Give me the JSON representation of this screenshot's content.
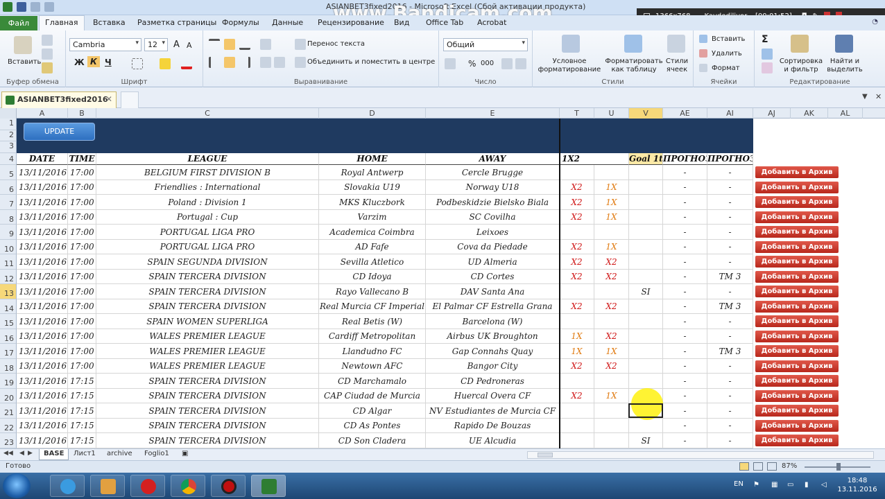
{
  "window": {
    "title": "ASIANBET3fixed2016 - Microsoft Excel (Сбой активации продукта)",
    "watermark": "www.Bandicam.com",
    "recorder_resolution": "1366x768",
    "recorder_status": "Kaydediliyor... [00:01:52]"
  },
  "menu": {
    "file": "Файл",
    "tabs": [
      "Главная",
      "Вставка",
      "Разметка страницы",
      "Формулы",
      "Данные",
      "Рецензирование",
      "Вид",
      "Office Tab",
      "Acrobat"
    ]
  },
  "ribbon": {
    "clipboard": {
      "paste": "Вставить",
      "label": "Буфер обмена"
    },
    "font": {
      "name": "Cambria",
      "size": "12",
      "label": "Шрифт",
      "bold": "Ж",
      "italic": "К",
      "underline": "Ч"
    },
    "alignment": {
      "wrap": "Перенос текста",
      "merge": "Объединить и поместить в центре",
      "label": "Выравнивание"
    },
    "number": {
      "format": "Общий",
      "label": "Число",
      "percent": "%",
      "thousands": "000"
    },
    "styles": {
      "conditional": "Условное форматирование",
      "as_table": "Форматировать как таблицу",
      "cell_styles": "Стили ячеек",
      "label": "Стили"
    },
    "cells": {
      "insert": "Вставить",
      "delete": "Удалить",
      "format": "Формат",
      "label": "Ячейки"
    },
    "editing": {
      "sort": "Сортировка и фильтр",
      "find": "Найти и выделить",
      "label": "Редактирование"
    }
  },
  "doc_tab": "ASIANBET3fixed2016",
  "columns": [
    "A",
    "B",
    "C",
    "D",
    "E",
    "T",
    "U",
    "V",
    "AE",
    "AI",
    "AJ",
    "AK",
    "AL"
  ],
  "update_button": "UPDATE",
  "headers": {
    "date": "DATE",
    "time": "TIME",
    "league": "LEAGUE",
    "home": "HOME",
    "away": "AWAY",
    "x12": "1X2",
    "goal": "Goal 1t",
    "prog1": "ПРОГНОЗ",
    "prog2": "ПРОГНОЗ"
  },
  "archive_label": "Добавить в Архив",
  "rows": [
    {
      "n": "5",
      "date": "13/11/2016",
      "time": "17:00",
      "league": "BELGIUM FIRST DIVISION B",
      "home": "Royal Antwerp",
      "away": "Cercle Brugge",
      "t": "",
      "u": "",
      "v": "",
      "ae": "-",
      "ai": "-"
    },
    {
      "n": "6",
      "date": "13/11/2016",
      "time": "17:00",
      "league": "Friendlies : International",
      "home": "Slovakia U19",
      "away": "Norway U18",
      "t": "X2",
      "u": "1X",
      "v": "",
      "ae": "-",
      "ai": "-"
    },
    {
      "n": "7",
      "date": "13/11/2016",
      "time": "17:00",
      "league": "Poland : Division 1",
      "home": "MKS Kluczbork",
      "away": "Podbeskidzie Bielsko Biala",
      "t": "X2",
      "u": "1X",
      "v": "",
      "ae": "-",
      "ai": "-"
    },
    {
      "n": "8",
      "date": "13/11/2016",
      "time": "17:00",
      "league": "Portugal : Cup",
      "home": "Varzim",
      "away": "SC Covilha",
      "t": "X2",
      "u": "1X",
      "v": "",
      "ae": "-",
      "ai": "-"
    },
    {
      "n": "9",
      "date": "13/11/2016",
      "time": "17:00",
      "league": "PORTUGAL LIGA PRO",
      "home": "Academica Coimbra",
      "away": "Leixoes",
      "t": "",
      "u": "",
      "v": "",
      "ae": "-",
      "ai": "-"
    },
    {
      "n": "10",
      "date": "13/11/2016",
      "time": "17:00",
      "league": "PORTUGAL LIGA PRO",
      "home": "AD Fafe",
      "away": "Cova da Piedade",
      "t": "X2",
      "u": "1X",
      "v": "",
      "ae": "-",
      "ai": "-"
    },
    {
      "n": "11",
      "date": "13/11/2016",
      "time": "17:00",
      "league": "SPAIN SEGUNDA DIVISION",
      "home": "Sevilla Atletico",
      "away": "UD Almeria",
      "t": "X2",
      "u": "X2",
      "v": "",
      "ae": "-",
      "ai": "-"
    },
    {
      "n": "12",
      "date": "13/11/2016",
      "time": "17:00",
      "league": "SPAIN TERCERA DIVISION",
      "home": "CD Idoya",
      "away": "CD Cortes",
      "t": "X2",
      "u": "X2",
      "v": "",
      "ae": "-",
      "ai": "TM 3"
    },
    {
      "n": "13",
      "date": "13/11/2016",
      "time": "17:00",
      "league": "SPAIN TERCERA DIVISION",
      "home": "Rayo Vallecano B",
      "away": "DAV Santa Ana",
      "t": "",
      "u": "",
      "v": "SI",
      "ae": "-",
      "ai": "-"
    },
    {
      "n": "14",
      "date": "13/11/2016",
      "time": "17:00",
      "league": "SPAIN TERCERA DIVISION",
      "home": "Real Murcia CF Imperial",
      "away": "El Palmar CF Estrella Grana",
      "t": "X2",
      "u": "X2",
      "v": "",
      "ae": "-",
      "ai": "TM 3"
    },
    {
      "n": "15",
      "date": "13/11/2016",
      "time": "17:00",
      "league": "SPAIN WOMEN SUPERLIGA",
      "home": "Real Betis (W)",
      "away": "Barcelona (W)",
      "t": "",
      "u": "",
      "v": "",
      "ae": "-",
      "ai": "-"
    },
    {
      "n": "16",
      "date": "13/11/2016",
      "time": "17:00",
      "league": "WALES PREMIER LEAGUE",
      "home": "Cardiff Metropolitan",
      "away": "Airbus UK Broughton",
      "t": "1X",
      "u": "X2",
      "v": "",
      "ae": "-",
      "ai": "-"
    },
    {
      "n": "17",
      "date": "13/11/2016",
      "time": "17:00",
      "league": "WALES PREMIER LEAGUE",
      "home": "Llandudno FC",
      "away": "Gap Connahs Quay",
      "t": "1X",
      "u": "1X",
      "v": "",
      "ae": "-",
      "ai": "TM 3"
    },
    {
      "n": "18",
      "date": "13/11/2016",
      "time": "17:00",
      "league": "WALES PREMIER LEAGUE",
      "home": "Newtown AFC",
      "away": "Bangor City",
      "t": "X2",
      "u": "X2",
      "v": "",
      "ae": "-",
      "ai": "-"
    },
    {
      "n": "19",
      "date": "13/11/2016",
      "time": "17:15",
      "league": "SPAIN TERCERA DIVISION",
      "home": "CD Marchamalo",
      "away": "CD Pedroneras",
      "t": "",
      "u": "",
      "v": "",
      "ae": "-",
      "ai": "-"
    },
    {
      "n": "20",
      "date": "13/11/2016",
      "time": "17:15",
      "league": "SPAIN TERCERA DIVISION",
      "home": "CAP Ciudad de Murcia",
      "away": "Huercal Overa CF",
      "t": "X2",
      "u": "1X",
      "v": "",
      "ae": "-",
      "ai": "-"
    },
    {
      "n": "21",
      "date": "13/11/2016",
      "time": "17:15",
      "league": "SPAIN TERCERA DIVISION",
      "home": "CD Algar",
      "away": "NV Estudiantes de Murcia CF",
      "t": "",
      "u": "",
      "v": "",
      "ae": "-",
      "ai": "-"
    },
    {
      "n": "22",
      "date": "13/11/2016",
      "time": "17:15",
      "league": "SPAIN TERCERA DIVISION",
      "home": "CD As Pontes",
      "away": "Rapido De Bouzas",
      "t": "",
      "u": "",
      "v": "",
      "ae": "-",
      "ai": "-"
    },
    {
      "n": "23",
      "date": "13/11/2016",
      "time": "17:15",
      "league": "SPAIN TERCERA DIVISION",
      "home": "CD Son Cladera",
      "away": "UE Alcudia",
      "t": "",
      "u": "",
      "v": "SI",
      "ae": "-",
      "ai": "-"
    }
  ],
  "sheets": [
    "BASE",
    "Лист1",
    "archive",
    "Foglio1"
  ],
  "status": {
    "ready": "Готово",
    "zoom": "87%"
  },
  "taskbar": {
    "lang": "EN",
    "time": "18:48",
    "date": "13.11.2016"
  },
  "colors": {
    "band": "#1f3a60",
    "x2": "#d01818",
    "x1": "#e07a10",
    "archive_button": "#c0392b",
    "file_tab": "#3a8a3a"
  }
}
